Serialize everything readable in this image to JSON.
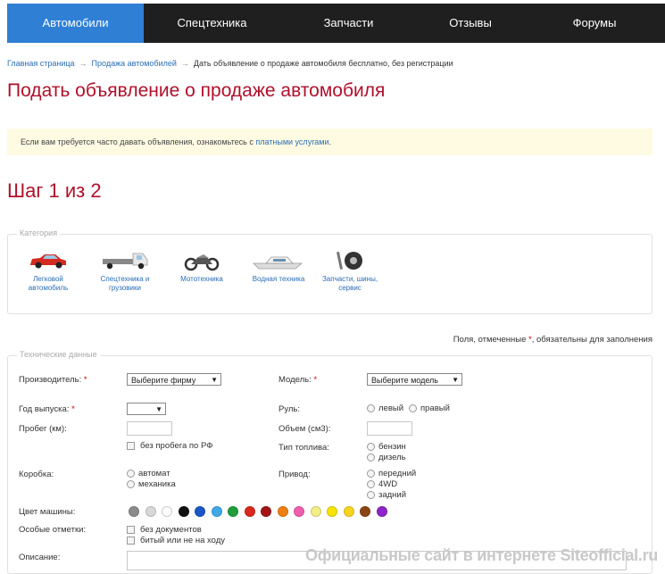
{
  "nav": {
    "items": [
      {
        "label": "Автомобили",
        "active": true
      },
      {
        "label": "Спецтехника"
      },
      {
        "label": "Запчасти"
      },
      {
        "label": "Отзывы"
      },
      {
        "label": "Форумы"
      }
    ]
  },
  "breadcrumb": {
    "home": "Главная страница",
    "section": "Продажа автомобилей",
    "separator": "→",
    "current": "Дать объявление о продаже автомобиля бесплатно, без регистрации"
  },
  "page_title": "Подать объявление о продаже автомобиля",
  "notice": {
    "text": "Если вам требуется часто давать объявления, ознакомьтесь с ",
    "link": "платными услугами",
    "end": "."
  },
  "step_title": "Шаг 1 из 2",
  "category": {
    "legend": "Категория",
    "items": [
      {
        "label": "Легковой автомобиль",
        "icon": "car-icon"
      },
      {
        "label": "Спецтехника и грузовики",
        "icon": "truck-icon"
      },
      {
        "label": "Мототехника",
        "icon": "motorcycle-icon"
      },
      {
        "label": "Водная техника",
        "icon": "boat-icon"
      },
      {
        "label": "Запчасти, шины, сервис",
        "icon": "tire-wrench-icon"
      }
    ]
  },
  "required_note": {
    "before": "Поля, отмеченные ",
    "star": "*",
    "after": ", обязательны для заполнения"
  },
  "tech": {
    "legend": "Технические данные",
    "manufacturer_label": "Производитель:",
    "manufacturer_select": "Выберите фирму",
    "model_label": "Модель:",
    "model_select": "Выберите модель",
    "year_label": "Год выпуска:",
    "year_select": "",
    "steering_label": "Руль:",
    "steering_left": "левый",
    "steering_right": "правый",
    "mileage_label": "Пробег (км):",
    "volume_label": "Объем (см3):",
    "no_mileage_rf": "без пробега по РФ",
    "fuel_label": "Тип топлива:",
    "fuel_options": [
      "бензин",
      "дизель"
    ],
    "gearbox_label": "Коробка:",
    "gearbox_options": [
      "автомат",
      "механика"
    ],
    "drive_label": "Привод:",
    "drive_options": [
      "передний",
      "4WD",
      "задний"
    ],
    "color_label": "Цвет машины:",
    "colors": [
      "#8c8c8c",
      "#d8d8d8",
      "#ffffff",
      "#111111",
      "#1a57c8",
      "#3fa9e8",
      "#1e9e3a",
      "#d9281c",
      "#a31515",
      "#f07f12",
      "#f05fae",
      "#f3ee86",
      "#f7e400",
      "#f7d51f",
      "#8b4513",
      "#8e24c9"
    ],
    "special_label": "Особые отметки:",
    "special_options": [
      "без документов",
      "битый или не на ходу"
    ],
    "description_label": "Описание:",
    "star": "*"
  },
  "watermark": "Официальные сайт в интернете Siteofficial.ru"
}
